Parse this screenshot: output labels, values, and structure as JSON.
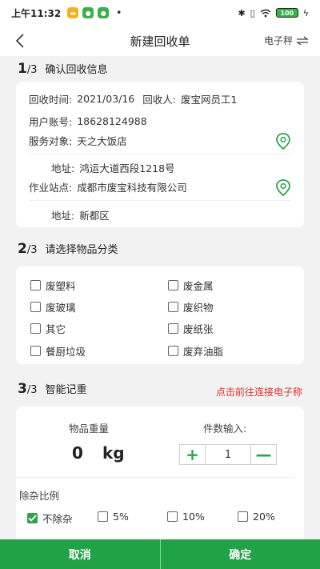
{
  "status_bar": {
    "time": "上午11:32",
    "dot": "•",
    "battery": "100"
  },
  "nav": {
    "title": "新建回收单",
    "right_label": "电子秤"
  },
  "step1": {
    "num": "1",
    "total": "/3",
    "title": "确认回收信息",
    "recycle_time_label": "回收时间:",
    "recycle_time": "2021/03/16",
    "recycler_label": "回收人:",
    "recycler": "废宝网员工1",
    "account_label": "用户账号:",
    "account": "18628124988",
    "service_label": "服务对象:",
    "service": "天之大饭店",
    "address_label": "地址:",
    "address1": "鸿运大道西段1218号",
    "station_label": "作业站点:",
    "station": "成都市废宝科技有限公司",
    "address2": "新都区"
  },
  "step2": {
    "num": "2",
    "total": "/3",
    "title": "请选择物品分类",
    "categories": [
      "废塑料",
      "废金属",
      "废玻璃",
      "废织物",
      "其它",
      "废纸张",
      "餐厨垃圾",
      "废弃油脂"
    ]
  },
  "step3": {
    "num": "3",
    "total": "/3",
    "title": "智能记重",
    "connect_link": "点击前往连接电子称",
    "weight_label": "物品重量",
    "weight_value": "0",
    "weight_unit": "kg",
    "count_label": "件数输入:",
    "count_value": "1",
    "plus": "+",
    "minus": "—",
    "impurity_label": "除杂比例",
    "impurity_options": [
      "不除杂",
      "5%",
      "10%",
      "20%"
    ]
  },
  "bottom": {
    "cancel": "取消",
    "confirm": "确定"
  },
  "colors": {
    "accent": "#21a246",
    "link": "#e0312a"
  }
}
